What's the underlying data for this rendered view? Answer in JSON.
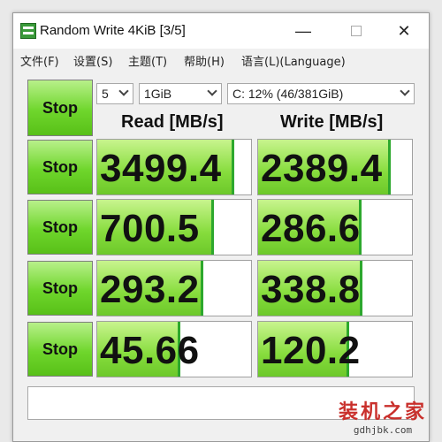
{
  "window": {
    "title": "Random Write 4KiB [3/5]",
    "controls": {
      "minimize": "—",
      "close": "✕"
    }
  },
  "menu": [
    "文件(F)",
    "设置(S)",
    "主题(T)",
    "帮助(H)",
    "语言(L)(Language)"
  ],
  "settings": {
    "count": "5",
    "size": "1GiB",
    "drive": "C: 12% (46/381GiB)"
  },
  "headers": {
    "read": "Read [MB/s]",
    "write": "Write [MB/s]"
  },
  "stop_label": "Stop",
  "rows": [
    {
      "read": "3499.4",
      "write": "2389.4",
      "read_fill": 0.89,
      "write_fill": 0.86
    },
    {
      "read": "700.5",
      "write": "286.6",
      "read_fill": 0.76,
      "write_fill": 0.67
    },
    {
      "read": "293.2",
      "write": "338.8",
      "read_fill": 0.69,
      "write_fill": 0.68
    },
    {
      "read": "45.66",
      "write": "120.2",
      "read_fill": 0.54,
      "write_fill": 0.59
    }
  ],
  "watermark": {
    "text": "装机之家",
    "url": "gdhjbk.com"
  },
  "colors": {
    "accent_green": "#6fd62c",
    "bar_green": "#86dc3c",
    "watermark_red": "#c9302c"
  }
}
